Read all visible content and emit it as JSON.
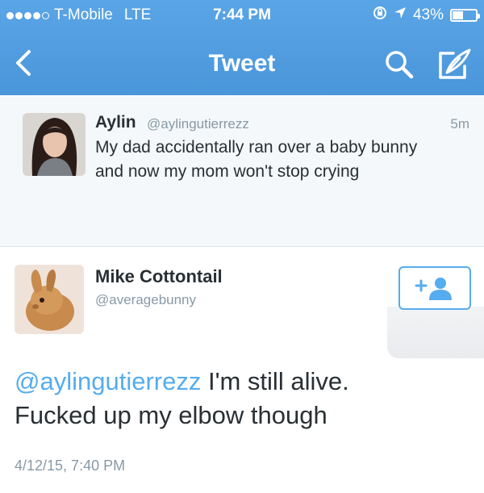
{
  "status_bar": {
    "carrier": "T-Mobile",
    "network": "LTE",
    "time": "7:44 PM",
    "battery": "43%",
    "battery_level": 0.43,
    "signal_bars": 4,
    "icons": [
      "lock-rotation-icon",
      "location-arrow-icon",
      "battery-icon"
    ]
  },
  "nav": {
    "title": "Tweet",
    "icons": [
      "back-chevron-icon",
      "search-icon",
      "compose-icon"
    ]
  },
  "replied_tweet": {
    "name": "Aylin",
    "handle": "@aylingutierrezz",
    "age": "5m",
    "text": "My dad accidentally ran over a baby bunny and now my mom won't stop crying"
  },
  "tweet": {
    "name": "Mike Cottontail",
    "handle": "@averagebunny",
    "mention": "@aylingutierrezz",
    "text_line1": "I'm still alive.",
    "text_line2": "Fucked up my elbow though",
    "timestamp": "4/12/15, 7:40 PM",
    "follow_icon": "add-user-icon"
  },
  "colors": {
    "nav_blue": "#4a96da",
    "accent": "#55acee",
    "muted": "#8899a6",
    "text": "#292f33"
  }
}
